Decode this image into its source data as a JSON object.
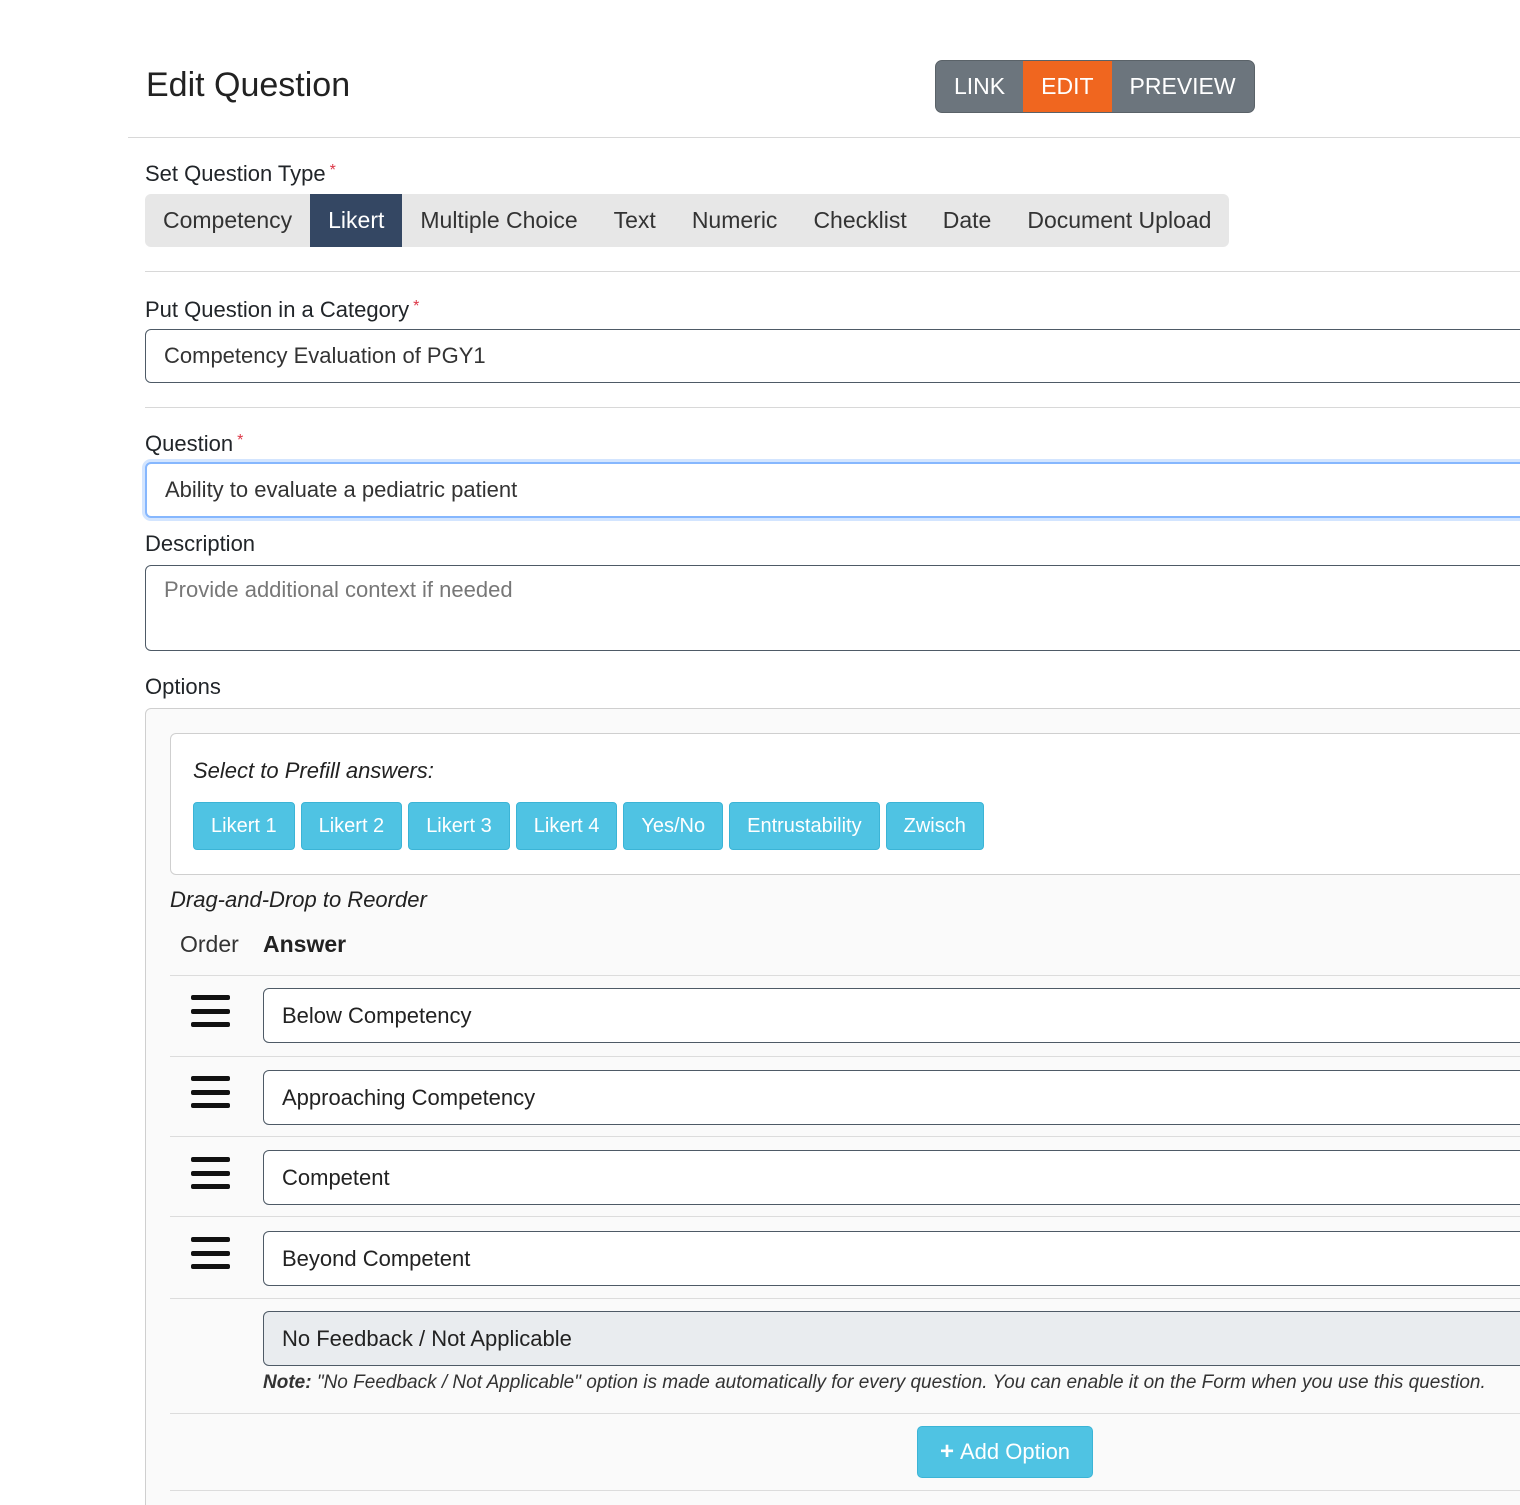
{
  "page": {
    "title": "Edit Question"
  },
  "modes": {
    "link": "LINK",
    "edit": "EDIT",
    "preview": "PREVIEW",
    "active": "EDIT"
  },
  "question_type": {
    "label": "Set Question Type",
    "required_mark": "*",
    "options": [
      "Competency",
      "Likert",
      "Multiple Choice",
      "Text",
      "Numeric",
      "Checklist",
      "Date",
      "Document Upload"
    ],
    "selected": "Likert"
  },
  "category": {
    "label": "Put Question in a Category",
    "required_mark": "*",
    "value": "Competency Evaluation of PGY1"
  },
  "question": {
    "label": "Question",
    "required_mark": "*",
    "value": "Ability to evaluate a pediatric patient"
  },
  "description": {
    "label": "Description",
    "placeholder": "Provide additional context if needed"
  },
  "options": {
    "label": "Options",
    "prefill_label": "Select to Prefill answers:",
    "prefill_buttons": [
      "Likert 1",
      "Likert 2",
      "Likert 3",
      "Likert 4",
      "Yes/No",
      "Entrustability",
      "Zwisch"
    ],
    "dnd_label": "Drag-and-Drop to Reorder",
    "col_order": "Order",
    "col_answer": "Answer",
    "answers": [
      "Below Competency",
      "Approaching Competency",
      "Competent",
      "Beyond Competent"
    ],
    "na_answer": "No Feedback / Not Applicable",
    "note_prefix": "Note:",
    "note_text": " \"No Feedback / Not Applicable\" option is made automatically for every question. You can enable it on the Form when you use this question.",
    "add_option": "Add Option"
  },
  "colors": {
    "accent_edit": "#f0661f",
    "mode_group": "#6c757d",
    "type_selected": "#344763",
    "prefill_btn": "#4fc3e3",
    "required": "#dc3545"
  }
}
